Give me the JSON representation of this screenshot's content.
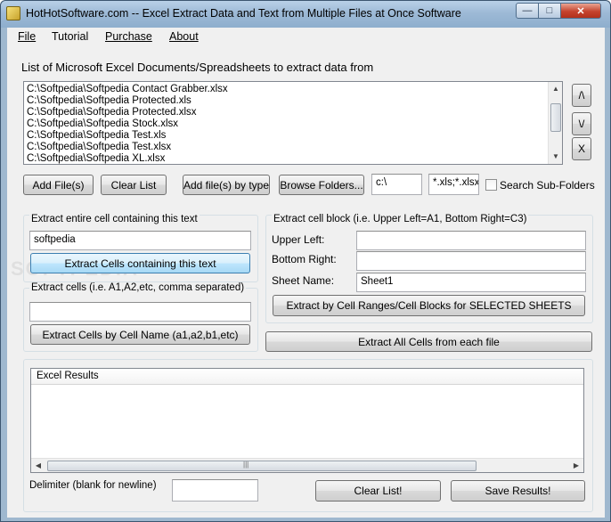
{
  "window": {
    "title": "HotHotSoftware.com -- Excel Extract Data and Text from Multiple Files at Once Software",
    "controls": {
      "minimize": "—",
      "maximize": "□",
      "close": "✕"
    }
  },
  "menu": {
    "file": "File",
    "tutorial": "Tutorial",
    "purchase": "Purchase",
    "about": "About"
  },
  "file_list": {
    "heading": "List of Microsoft Excel Documents/Spreadsheets to extract data from",
    "items": [
      "C:\\Softpedia\\Softpedia Contact Grabber.xlsx",
      "C:\\Softpedia\\Softpedia Protected.xls",
      "C:\\Softpedia\\Softpedia Protected.xlsx",
      "C:\\Softpedia\\Softpedia Stock.xlsx",
      "C:\\Softpedia\\Softpedia Test.xls",
      "C:\\Softpedia\\Softpedia Test.xlsx",
      "C:\\Softpedia\\Softpedia XL.xlsx"
    ],
    "move_up": "/\\",
    "move_down": "\\/",
    "remove": "X"
  },
  "toolbar": {
    "add_files": "Add File(s)",
    "clear_list": "Clear List",
    "add_by_type": "Add file(s) by type",
    "browse_folders": "Browse Folders...",
    "folder_path": "c:\\",
    "file_types": "*.xls;*.xlsx",
    "search_subfolders": "Search Sub-Folders",
    "search_subfolders_checked": false
  },
  "extract_text": {
    "title": "Extract entire cell containing this text",
    "value": "softpedia",
    "button": "Extract Cells containing this text"
  },
  "extract_cells": {
    "title": "Extract cells  (i.e. A1,A2,etc, comma separated)",
    "value": "",
    "button": "Extract Cells by Cell Name (a1,a2,b1,etc)"
  },
  "extract_block": {
    "title": "Extract cell block (i.e. Upper Left=A1, Bottom Right=C3)",
    "upper_left_label": "Upper Left:",
    "upper_left_value": "",
    "bottom_right_label": "Bottom Right:",
    "bottom_right_value": "",
    "sheet_name_label": "Sheet Name:",
    "sheet_name_value": "Sheet1",
    "button": "Extract by Cell Ranges/Cell Blocks for SELECTED SHEETS"
  },
  "extract_all": {
    "button": "Extract All Cells from each file"
  },
  "results": {
    "column_header": "Excel Results",
    "delimiter_label": "Delimiter (blank for newline)",
    "delimiter_value": "",
    "clear_button": "Clear List!",
    "save_button": "Save Results!"
  },
  "watermark": "SOFTPEDIA"
}
